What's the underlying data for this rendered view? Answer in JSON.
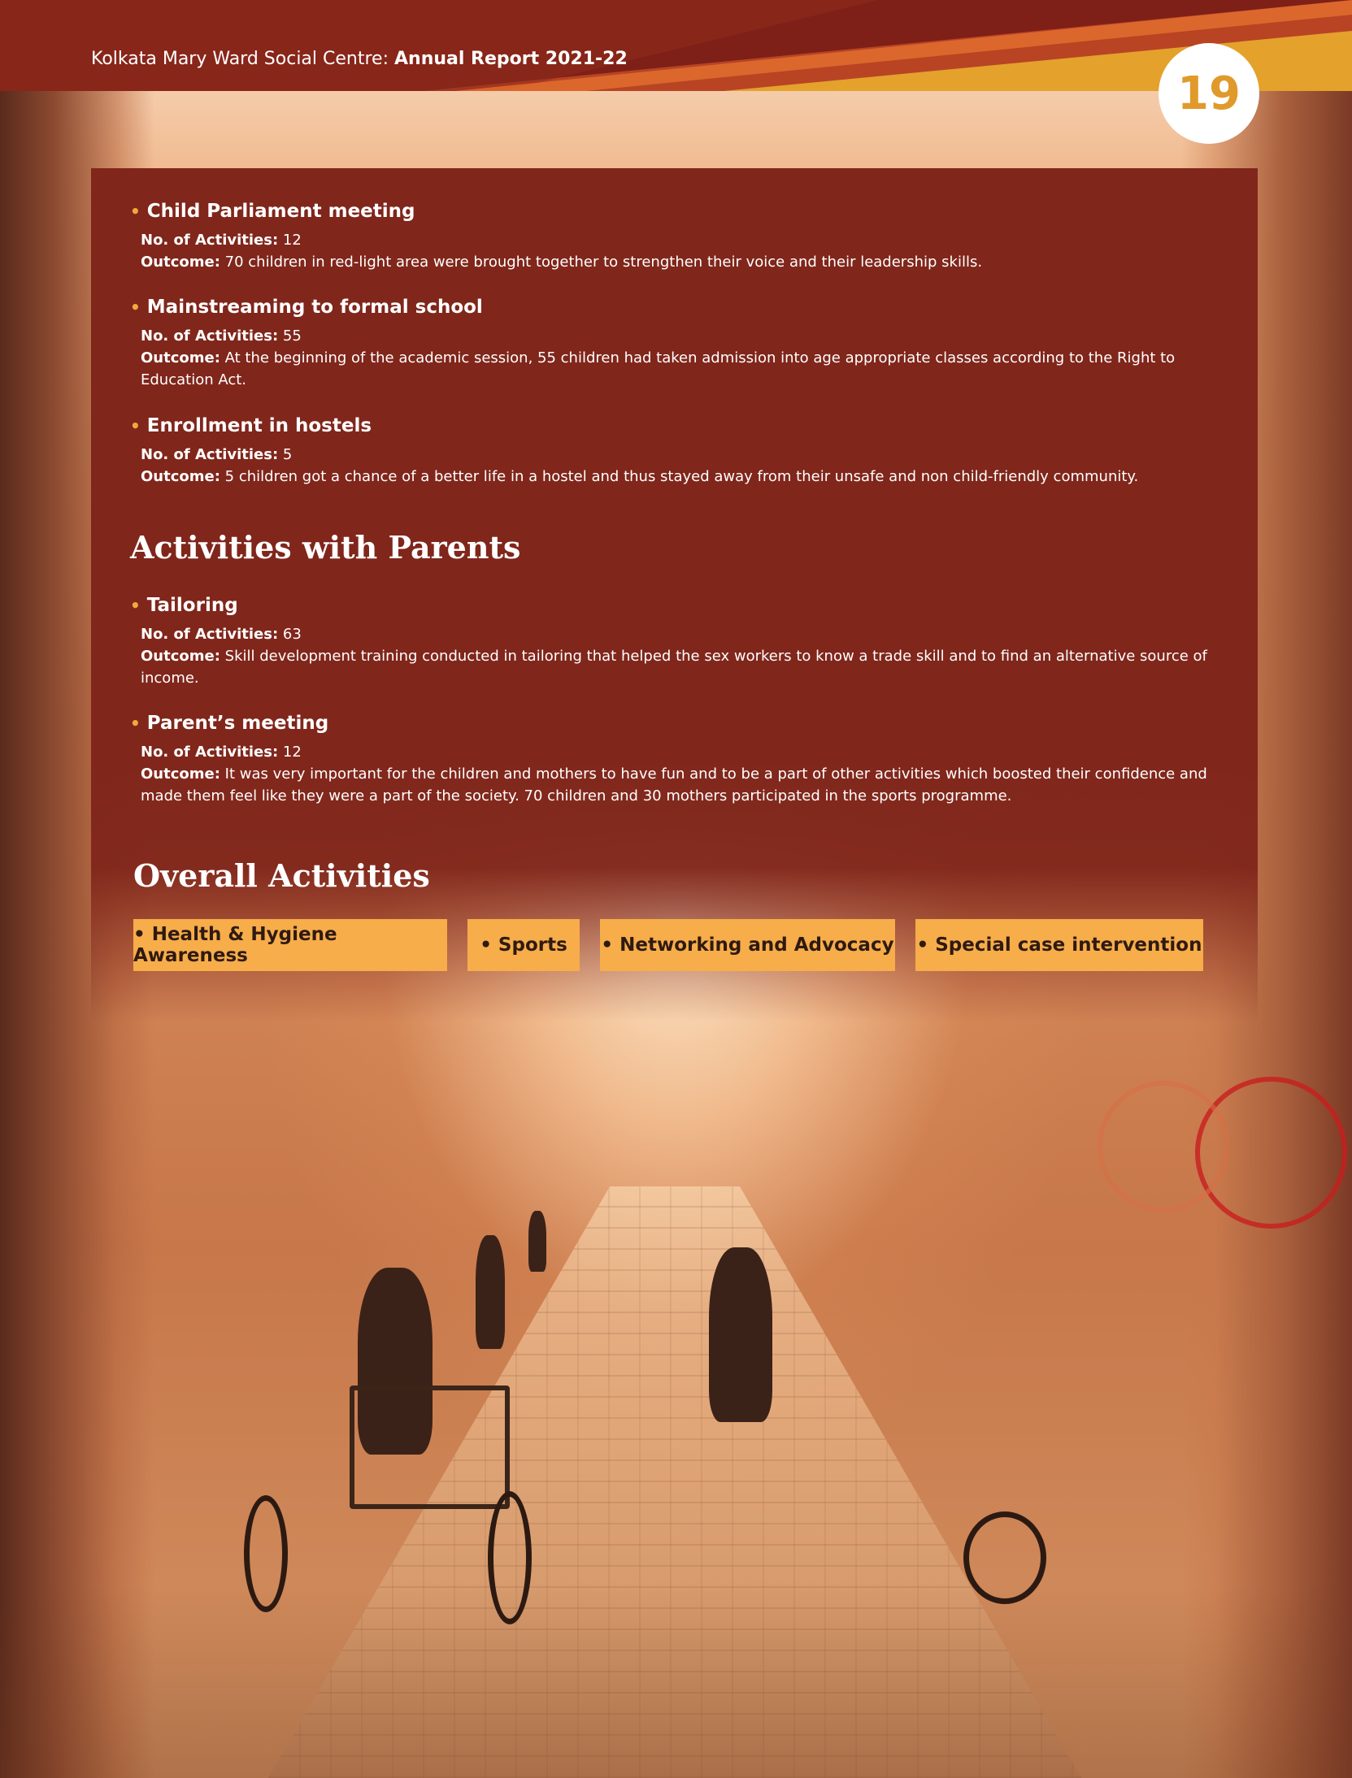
{
  "header": {
    "org": "Kolkata Mary Ward Social Centre:",
    "report": "Annual Report 2021-22",
    "page_number": "19"
  },
  "labels": {
    "count": "No. of Activities:",
    "outcome": "Outcome:"
  },
  "children_activities": [
    {
      "title": "Child Parliament meeting",
      "count": "12",
      "outcome": "70 children in red-light area were brought together to strengthen their voice and their leadership skills."
    },
    {
      "title": "Mainstreaming to formal school",
      "count": "55",
      "outcome": "At the beginning of the academic session, 55 children had taken admission into age appropriate classes according to the Right to Education Act."
    },
    {
      "title": "Enrollment in hostels",
      "count": "5",
      "outcome": "5 children got a chance of a better life in a hostel and thus stayed away from their unsafe and non child-friendly community."
    }
  ],
  "parents_section": {
    "heading": "Activities with Parents",
    "items": [
      {
        "title": "Tailoring",
        "count": "63",
        "outcome": "Skill development training conducted in tailoring that helped the sex workers to know a trade skill and to find an alternative source of income."
      },
      {
        "title": "Parent’s meeting",
        "count": "12",
        "outcome": "It was very important for the children and mothers to have fun and to be a part of other activities which boosted their confidence and made them feel like they were a part of the society. 70 children and 30 mothers participated in the sports programme."
      }
    ]
  },
  "overall_section": {
    "heading": "Overall Activities",
    "chips": [
      "• Health & Hygiene Awareness",
      "• Sports",
      "• Networking and Advocacy",
      "• Special case intervention"
    ]
  },
  "colors": {
    "panel": "#80261b",
    "accent": "#f2a83b",
    "chip": "#f6ad4a",
    "page_number": "#e09a2c"
  }
}
